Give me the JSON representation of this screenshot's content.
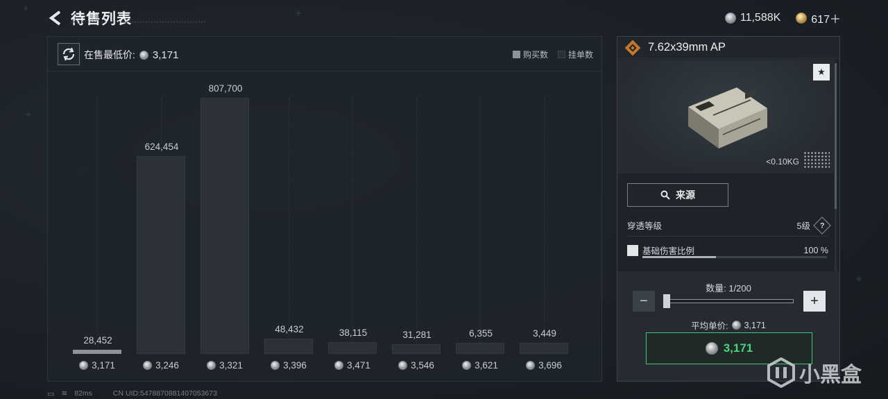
{
  "header": {
    "title": "待售列表"
  },
  "currencies": [
    {
      "icon": "silver-coin-icon",
      "value": "11,588K"
    },
    {
      "icon": "gold-coin-icon",
      "value": "617＋"
    }
  ],
  "chart_panel": {
    "lowest_label": "在售最低价:",
    "lowest_value": "3,171",
    "legend": [
      {
        "label": "购买数",
        "color": "#8d9398"
      },
      {
        "label": "挂单数",
        "color": "#2b3136"
      }
    ]
  },
  "chart_data": {
    "type": "bar",
    "categories": [
      "3,171",
      "3,246",
      "3,321",
      "3,396",
      "3,471",
      "3,546",
      "3,621",
      "3,696"
    ],
    "values": [
      28452,
      624454,
      807700,
      48432,
      38115,
      31281,
      6355,
      3449
    ],
    "value_labels": [
      "28,452",
      "624,454",
      "807,700",
      "48,432",
      "38,115",
      "31,281",
      "6,355",
      "3,449"
    ],
    "series": [
      {
        "name": "挂单数",
        "values": [
          28452,
          624454,
          807700,
          48432,
          38115,
          31281,
          6355,
          3449
        ]
      }
    ],
    "ylim": [
      0,
      807700
    ]
  },
  "item": {
    "name": "7.62x39mm AP",
    "weight": "<0.10KG",
    "source_label": "来源",
    "penetration_label": "穿透等级",
    "penetration_value": "5级",
    "damage_label": "基础伤害比例",
    "damage_value": "100 %",
    "damage_fraction": 0.4
  },
  "buy": {
    "qty_label": "数量: 1/200",
    "qty_fraction": 0.0,
    "avg_label": "平均单价:",
    "avg_value": "3,171",
    "buy_price": "3,171"
  },
  "footer": {
    "ping": "82ms",
    "uid": "CN UID:5478870881407053673"
  },
  "watermark": {
    "text": "小黑盒"
  }
}
